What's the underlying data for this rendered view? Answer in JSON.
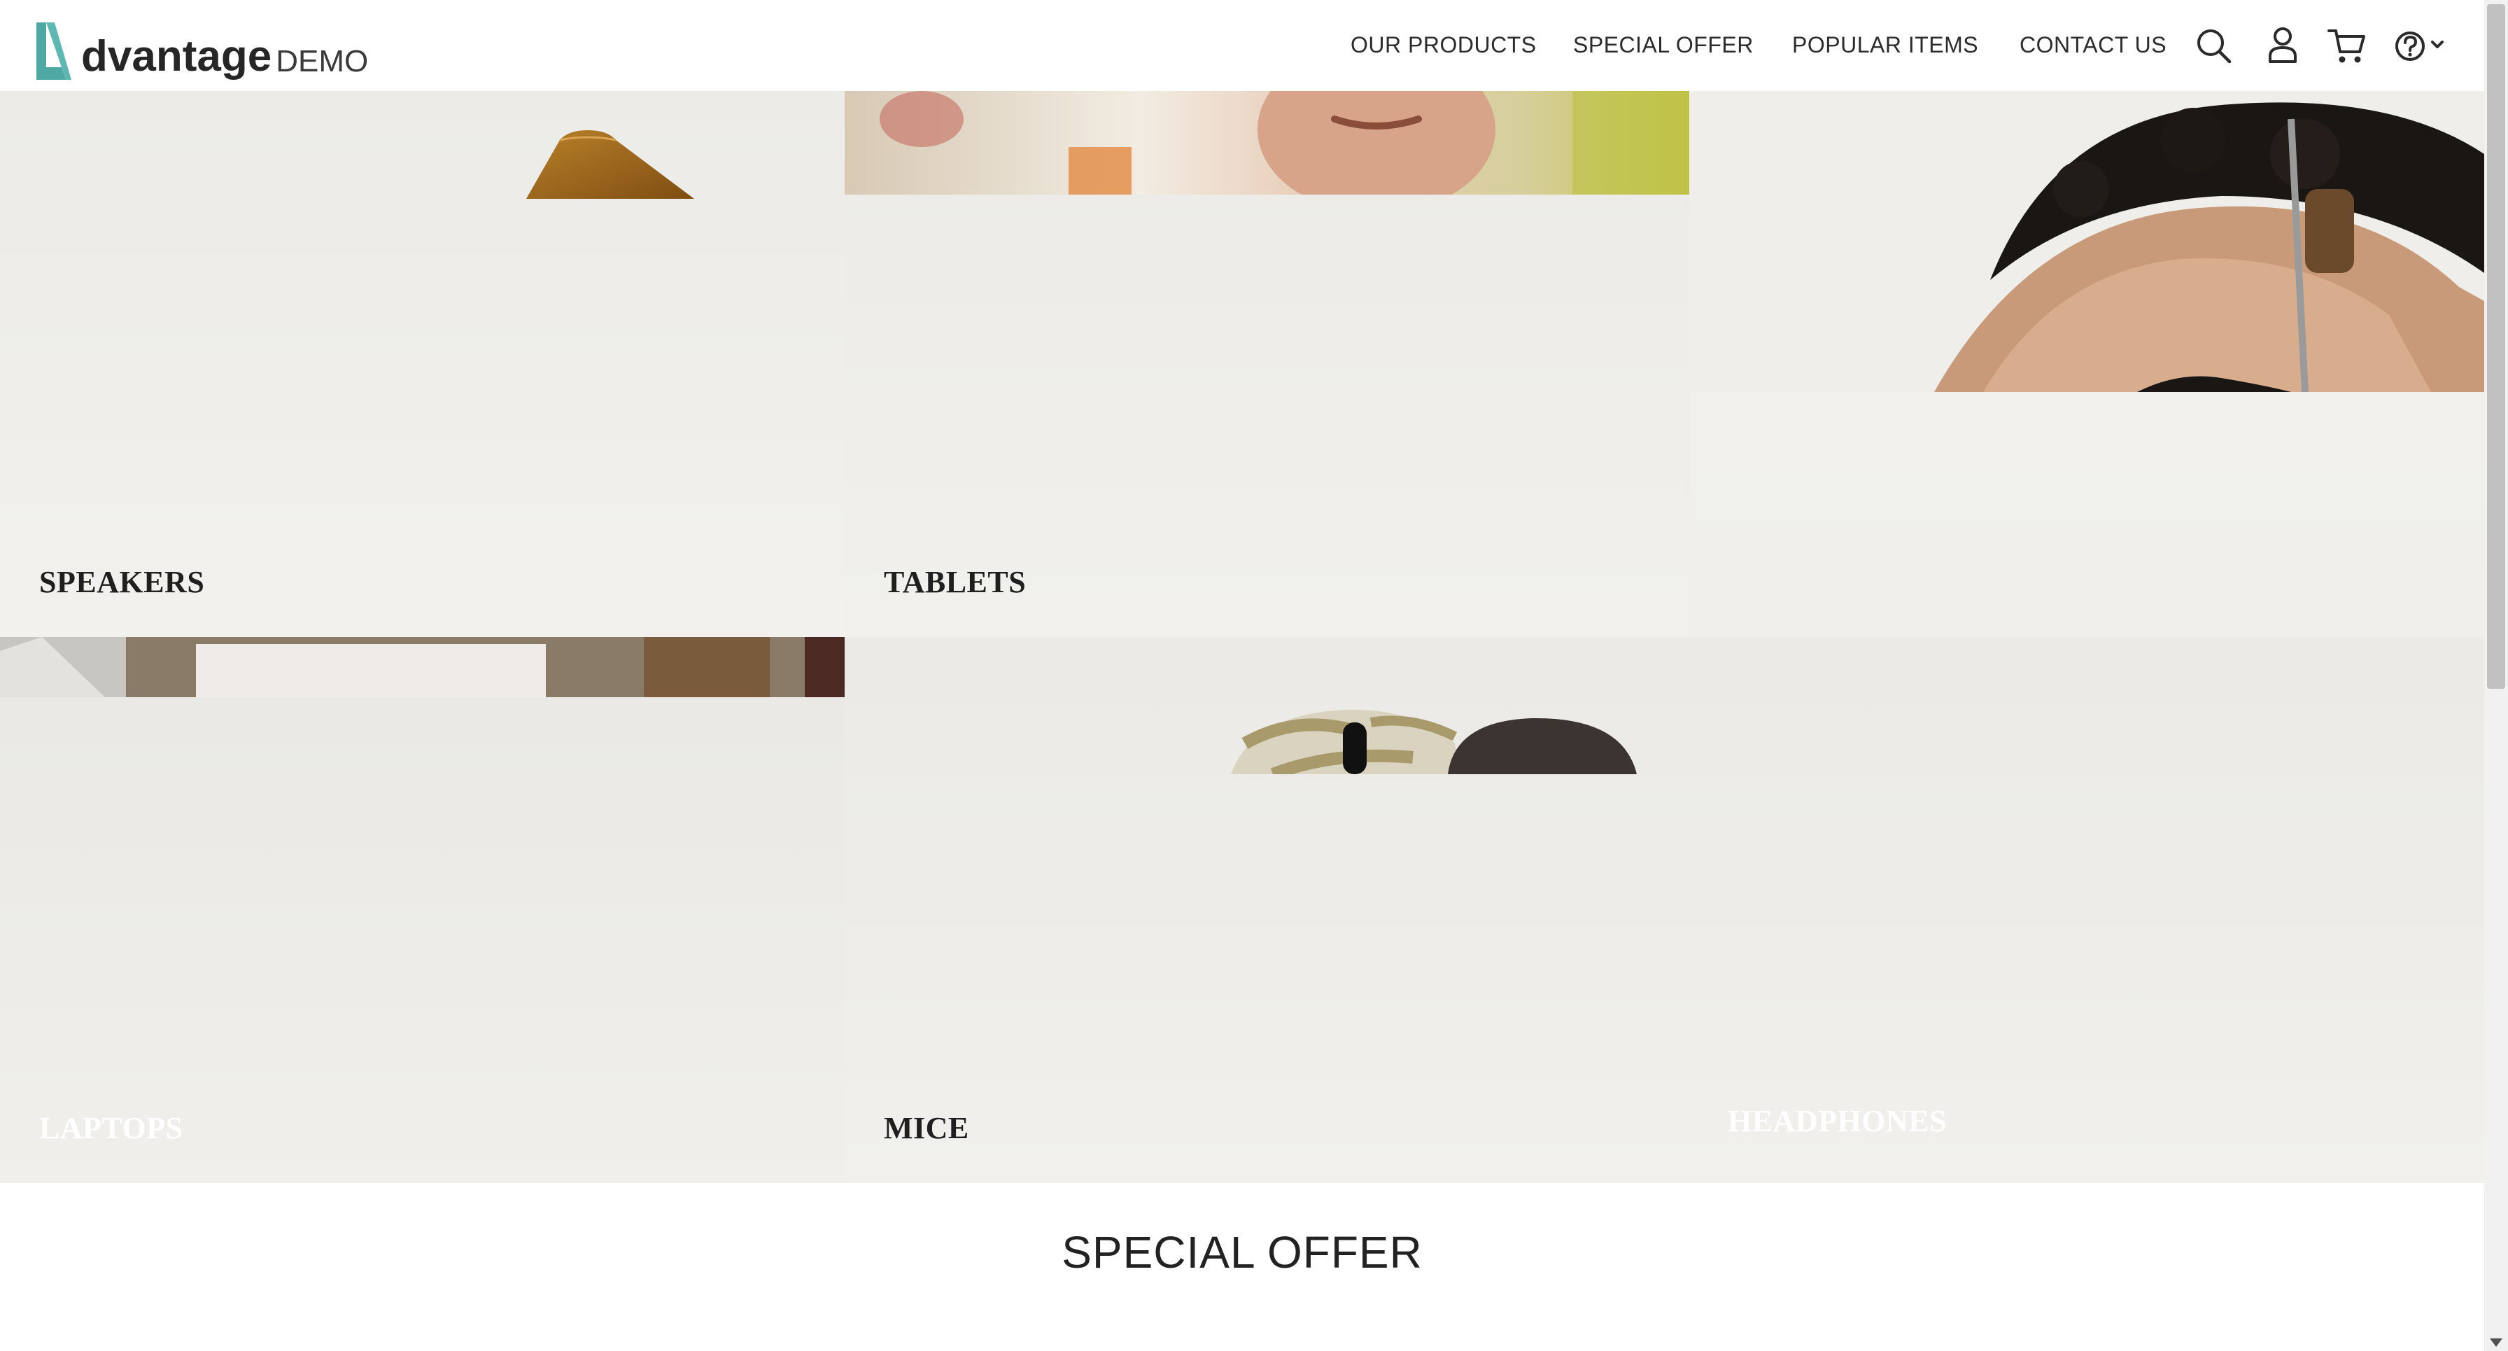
{
  "header": {
    "logo_word": "dvantage",
    "logo_demo": "DEMO",
    "nav": [
      {
        "label": "OUR PRODUCTS"
      },
      {
        "label": "SPECIAL OFFER"
      },
      {
        "label": "POPULAR ITEMS"
      },
      {
        "label": "CONTACT US"
      }
    ],
    "icons": [
      "search-icon",
      "user-icon",
      "cart-icon",
      "help-icon"
    ],
    "accent_color": "#4fa8a3"
  },
  "categories": {
    "speakers": {
      "label": "SPEAKERS"
    },
    "tablets": {
      "label": "TABLETS"
    },
    "laptops": {
      "label": "LAPTOPS"
    },
    "mice": {
      "label": "MICE"
    },
    "headphones": {
      "label": "HEADPHONES"
    }
  },
  "sections": {
    "special_offer_title": "SPECIAL OFFER"
  }
}
